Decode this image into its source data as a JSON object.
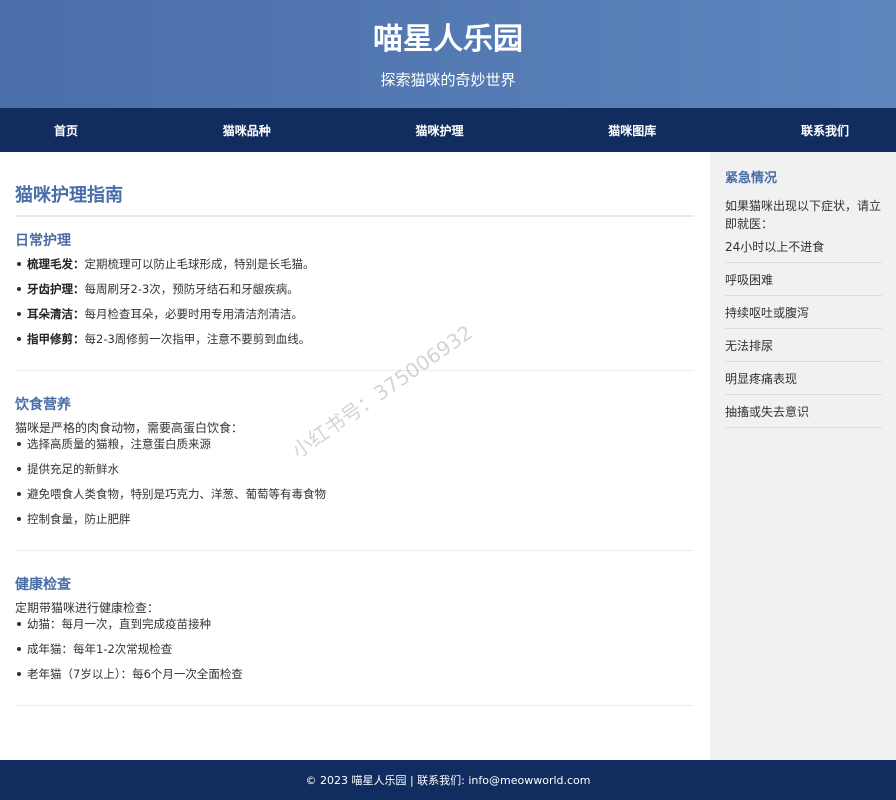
{
  "header": {
    "title": "喵星人乐园",
    "subtitle": "探索猫咪的奇妙世界"
  },
  "nav": {
    "items": [
      "首页",
      "猫咪品种",
      "猫咪护理",
      "猫咪图库",
      "联系我们"
    ]
  },
  "main": {
    "title": "猫咪护理指南",
    "daily": {
      "title": "日常护理",
      "items": [
        {
          "label": "梳理毛发：",
          "text": "定期梳理可以防止毛球形成，特别是长毛猫。"
        },
        {
          "label": "牙齿护理：",
          "text": "每周刷牙2-3次，预防牙结石和牙龈疾病。"
        },
        {
          "label": "耳朵清洁：",
          "text": "每月检查耳朵，必要时用专用清洁剂清洁。"
        },
        {
          "label": "指甲修剪：",
          "text": "每2-3周修剪一次指甲，注意不要剪到血线。"
        }
      ]
    },
    "diet": {
      "title": "饮食营养",
      "intro": "猫咪是严格的肉食动物，需要高蛋白饮食：",
      "items": [
        "选择高质量的猫粮，注意蛋白质来源",
        "提供充足的新鲜水",
        "避免喂食人类食物，特别是巧克力、洋葱、葡萄等有毒食物",
        "控制食量，防止肥胖"
      ]
    },
    "health": {
      "title": "健康检查",
      "intro": "定期带猫咪进行健康检查：",
      "items": [
        "幼猫：每月一次，直到完成疫苗接种",
        "成年猫：每年1-2次常规检查",
        "老年猫（7岁以上）：每6个月一次全面检查"
      ]
    }
  },
  "sidebar": {
    "title": "紧急情况",
    "intro": "如果猫咪出现以下症状，请立即就医：",
    "symptoms": [
      "24小时以上不进食",
      "呼吸困难",
      "持续呕吐或腹泻",
      "无法排尿",
      "明显疼痛表现",
      "抽搐或失去意识"
    ]
  },
  "watermark": "小红书号：375006932",
  "footer": {
    "text": "© 2023 喵星人乐园 | 联系我们: info@meowworld.com"
  }
}
